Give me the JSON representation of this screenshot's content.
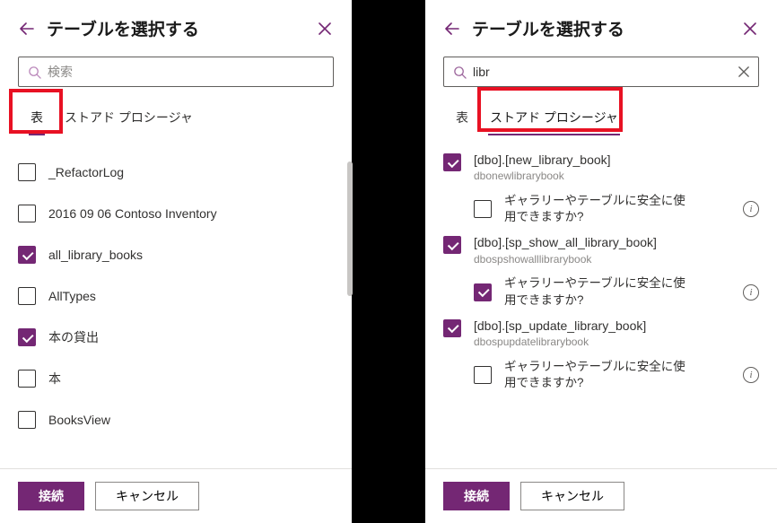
{
  "colors": {
    "accent": "#742774",
    "highlight_box": "#e81123"
  },
  "left": {
    "title": "テーブルを選択する",
    "search_placeholder": "検索",
    "search_value": "",
    "tabs": {
      "tables": "表",
      "procs": "ストアド プロシージャ",
      "active": "tables"
    },
    "rows": [
      {
        "label": "_RefactorLog",
        "checked": false
      },
      {
        "label": "2016 09 06 Contoso Inventory",
        "checked": false
      },
      {
        "label": "all_library_books",
        "checked": true
      },
      {
        "label": "AllTypes",
        "checked": false
      },
      {
        "label": "本の貸出",
        "checked": true
      },
      {
        "label": "本",
        "checked": false
      },
      {
        "label": "BooksView",
        "checked": false
      }
    ],
    "connect": "接続",
    "cancel": "キャンセル"
  },
  "right": {
    "title": "テーブルを選択する",
    "search_placeholder": "",
    "search_value": "libr",
    "tabs": {
      "tables": "表",
      "procs": "ストアド プロシージャ",
      "active": "procs"
    },
    "safe_question": "ギャラリーやテーブルに安全に使用できますか?",
    "items": [
      {
        "title": "[dbo].[new_library_book]",
        "sub": "dbonewlibrarybook",
        "checked": true,
        "safe_checked": false
      },
      {
        "title": "[dbo].[sp_show_all_library_book]",
        "sub": "dbospshowalllibrarybook",
        "checked": true,
        "safe_checked": true
      },
      {
        "title": "[dbo].[sp_update_library_book]",
        "sub": "dbospupdatelibrarybook",
        "checked": true,
        "safe_checked": false
      }
    ],
    "connect": "接続",
    "cancel": "キャンセル"
  }
}
